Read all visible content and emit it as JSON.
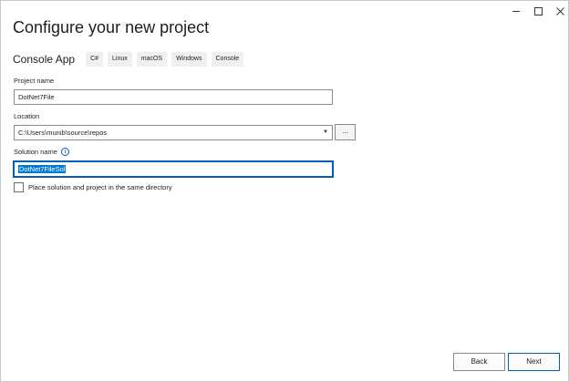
{
  "window": {
    "title": "Configure your new project",
    "controls": [
      "minimize-icon",
      "maximize-icon",
      "close-icon"
    ]
  },
  "template": {
    "name": "Console App",
    "tags": [
      "C#",
      "Linux",
      "macOS",
      "Windows",
      "Console"
    ]
  },
  "project_name": {
    "label": "Project name",
    "value": "DotNet7File"
  },
  "location": {
    "label": "Location",
    "value": "C:\\Users\\munib\\source\\repos",
    "browse_label": "..."
  },
  "solution_name": {
    "label": "Solution name",
    "value": "DotNet7FileSol"
  },
  "same_directory": {
    "label": "Place solution and project in the same directory",
    "checked": false
  },
  "footer": {
    "back_label": "Back",
    "next_label": "Next"
  },
  "colors": {
    "accent": "#005fb8",
    "selection": "#0078d4"
  }
}
